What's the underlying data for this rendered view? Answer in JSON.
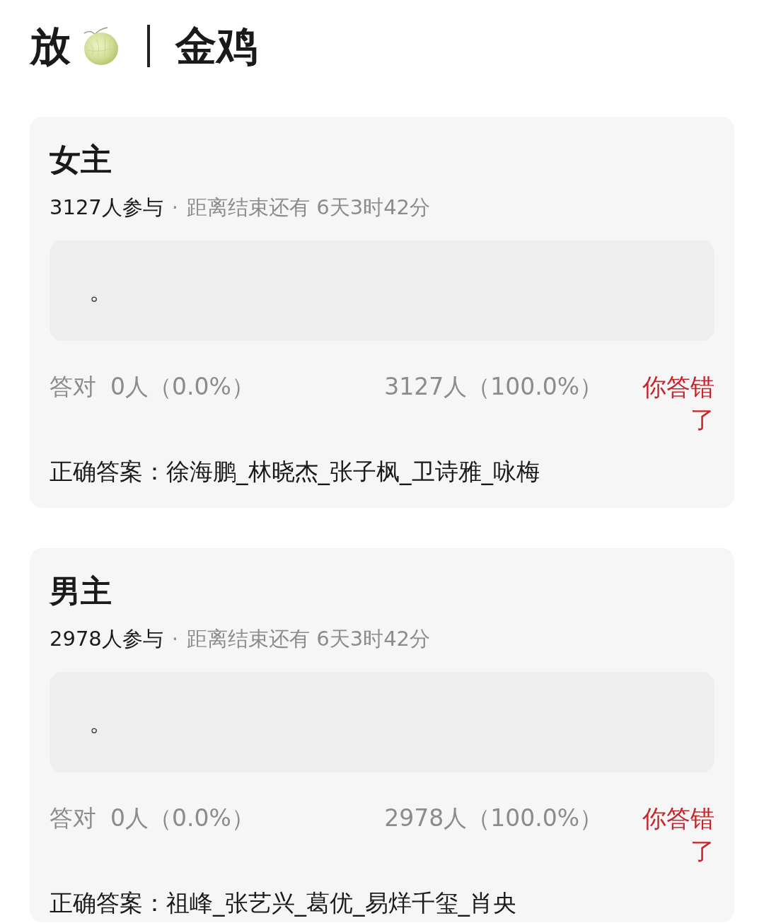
{
  "header": {
    "lead": "放",
    "tail": "金鸡"
  },
  "polls": [
    {
      "title": "女主",
      "participants": "3127人参与",
      "separator": "·",
      "deadline": "距离结束还有 6天3时42分",
      "options": [
        {
          "text": "。"
        }
      ],
      "results": {
        "correct_label": "答对",
        "correct_count": "0人（0.0%）",
        "wrong_count": "3127人（100.0%）",
        "verdict": "你答错了",
        "user_correct": false
      },
      "answer": "正确答案：徐海鹏_林晓杰_张子枫_卫诗雅_咏梅"
    },
    {
      "title": "男主",
      "participants": "2978人参与",
      "separator": "·",
      "deadline": "距离结束还有 6天3时42分",
      "options": [
        {
          "text": "。"
        }
      ],
      "results": {
        "correct_label": "答对",
        "correct_count": "0人（0.0%）",
        "wrong_count": "2978人（100.0%）",
        "verdict": "你答错了",
        "user_correct": false
      },
      "answer": "正确答案：祖峰_张艺兴_葛优_易烊千玺_肖央"
    }
  ]
}
